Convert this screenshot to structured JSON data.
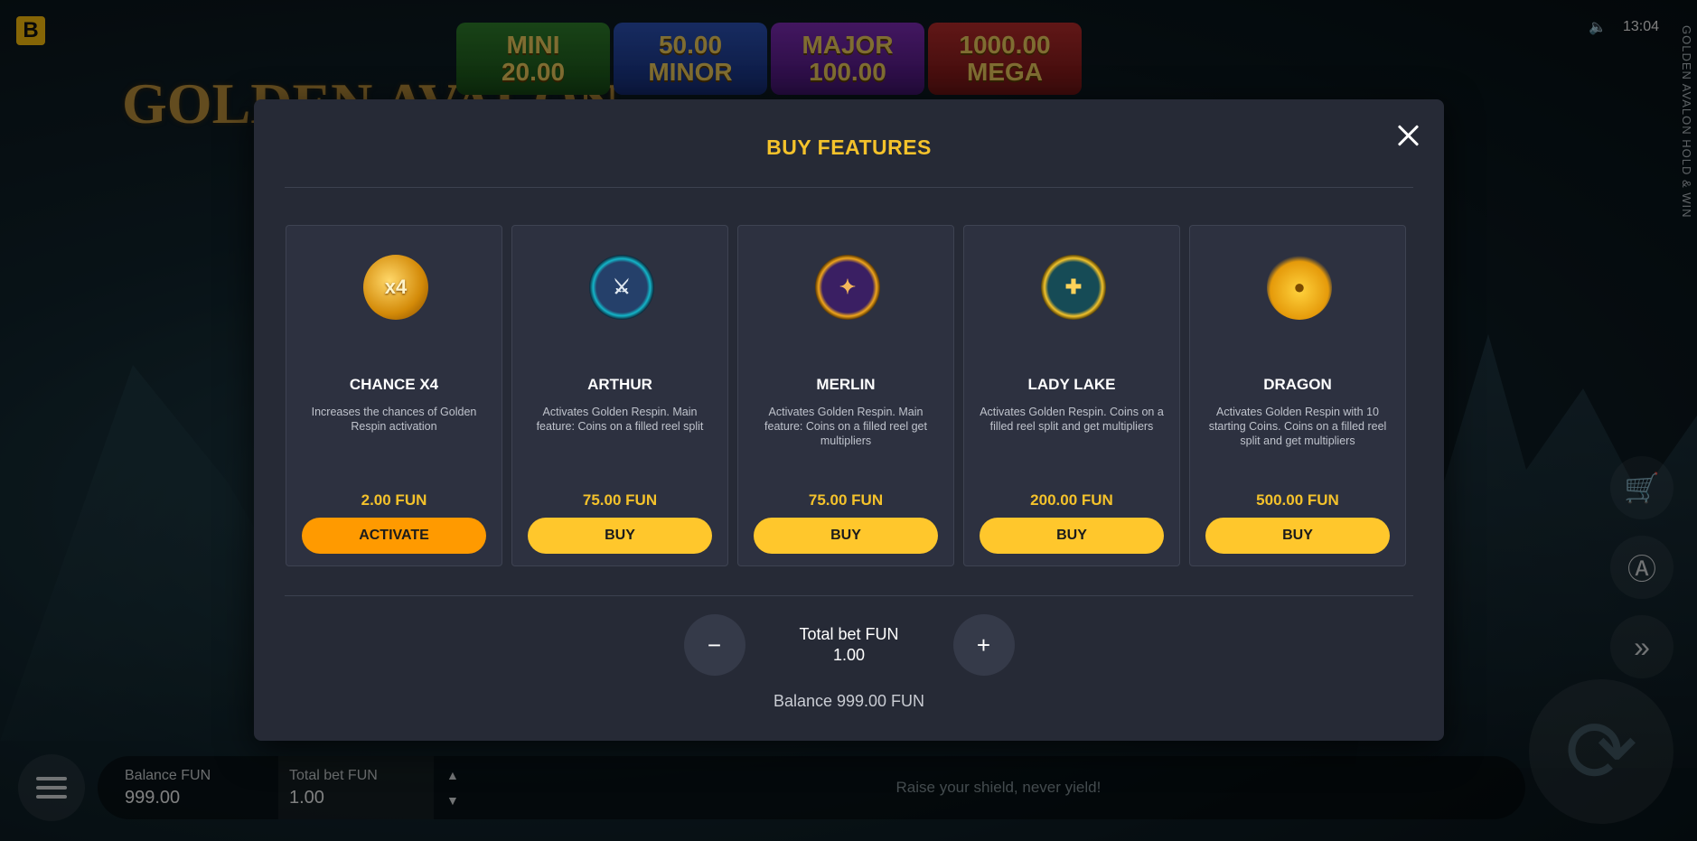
{
  "brand": {
    "letter": "B"
  },
  "game": {
    "logo_text": "GOLDEN AVALON",
    "side_title": "GOLDEN AVALON HOLD & WIN"
  },
  "status": {
    "time": "13:04",
    "sound_icon": "speaker-icon"
  },
  "jackpots": [
    {
      "name": "MINI",
      "value": "20.00"
    },
    {
      "name": "MINOR",
      "value": "50.00"
    },
    {
      "name": "MAJOR",
      "value": "100.00"
    },
    {
      "name": "MEGA",
      "value": "1000.00"
    }
  ],
  "modal": {
    "title": "BUY FEATURES",
    "cards": [
      {
        "name": "CHANCE X4",
        "icon_text": "x4",
        "desc": "Increases the chances of Golden Respin activation",
        "price": "2.00 FUN",
        "button": "ACTIVATE"
      },
      {
        "name": "ARTHUR",
        "icon_text": "⚔",
        "desc": "Activates Golden Respin. Main feature: Coins on a filled reel split",
        "price": "75.00 FUN",
        "button": "BUY"
      },
      {
        "name": "MERLIN",
        "icon_text": "✦",
        "desc": "Activates Golden Respin. Main feature: Coins on a filled reel get multipliers",
        "price": "75.00 FUN",
        "button": "BUY"
      },
      {
        "name": "LADY LAKE",
        "icon_text": "✚",
        "desc": "Activates Golden Respin. Coins on a filled reel split and get multipliers",
        "price": "200.00 FUN",
        "button": "BUY"
      },
      {
        "name": "DRAGON",
        "icon_text": "●",
        "desc": "Activates Golden Respin with 10 starting Coins. Coins on a filled reel split and get multipliers",
        "price": "500.00 FUN",
        "button": "BUY"
      }
    ],
    "bet": {
      "label": "Total bet FUN",
      "value": "1.00",
      "minus": "−",
      "plus": "+"
    },
    "balance": "Balance 999.00 FUN"
  },
  "bottom": {
    "balance_label": "Balance FUN",
    "balance_value": "999.00",
    "totalbet_label": "Total bet FUN",
    "totalbet_value": "1.00",
    "message": "Raise your shield, never yield!"
  },
  "controls": {
    "cart": "🛒",
    "auto": "Ⓐ",
    "turbo": "»",
    "spin": "⟳"
  }
}
